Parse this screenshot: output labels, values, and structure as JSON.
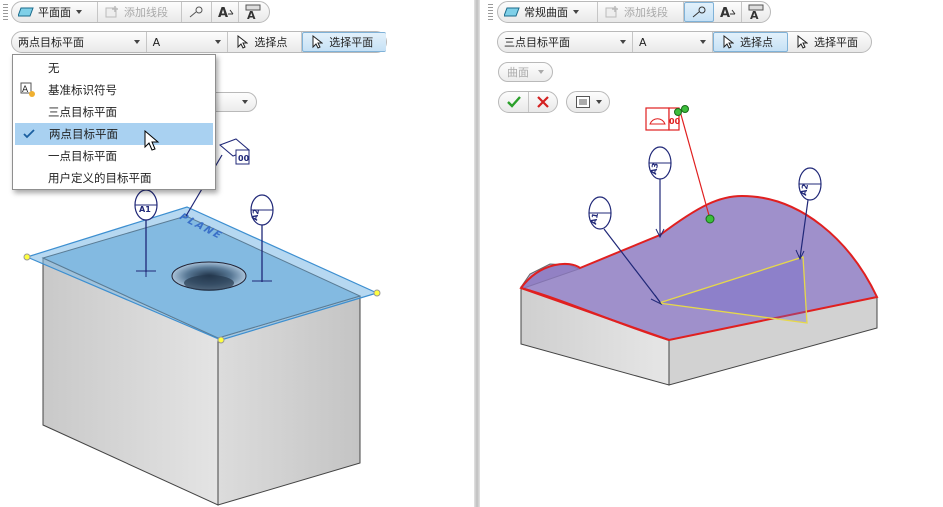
{
  "left": {
    "toolbar": {
      "mode_label": "平面面",
      "add_segment_label": "添加线段"
    },
    "row2": {
      "target_type": "两点目标平面",
      "label_value": "A",
      "select_point": "选择点",
      "select_plane": "选择平面"
    },
    "dropdown": {
      "items": [
        {
          "label": "无"
        },
        {
          "label": "基准标识符号"
        },
        {
          "label": "三点目标平面"
        },
        {
          "label": "两点目标平面",
          "checked": true
        },
        {
          "label": "一点目标平面"
        },
        {
          "label": "用户定义的目标平面"
        }
      ]
    },
    "model": {
      "callouts": [
        "A1",
        "A2"
      ],
      "surface_text": "PLANE"
    }
  },
  "right": {
    "toolbar": {
      "mode_label": "常规曲面",
      "add_segment_label": "添加线段"
    },
    "row2": {
      "target_type": "三点目标平面",
      "label_value": "A",
      "select_point": "选择点",
      "select_plane": "选择平面"
    },
    "surface_combo": "曲面",
    "model": {
      "callouts": [
        "A1",
        "A3",
        "A2"
      ],
      "frame_symbol": "00"
    }
  },
  "colors": {
    "selection_blue": "#7ab8e6",
    "highlight_red": "#e02020",
    "callout_navy": "#202878",
    "surface_purple": "#8a78c0",
    "ok_green": "#2aa02a",
    "cancel_red": "#d42020",
    "menu_highlight": "#a9d1f1"
  }
}
